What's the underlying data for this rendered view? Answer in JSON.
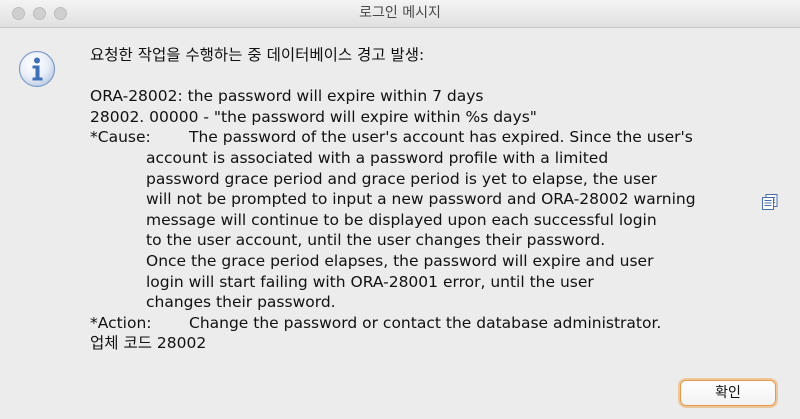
{
  "window": {
    "title": "로그인 메시지"
  },
  "icons": {
    "info": "info-icon",
    "copy": "copy-icon"
  },
  "message": {
    "heading": "요청한 작업을 수행하는 중 데이터베이스 경고 발생:",
    "line1": "ORA-28002: the password will expire within 7 days",
    "line2": "28002. 00000 -  \"the password will expire within %s days\"",
    "cause_label": "*Cause:",
    "cause_lines": [
      "The password of the user's account has expired. Since the user's",
      "account is associated with a password profile with a limited",
      "password grace period and grace period is yet to elapse, the user",
      "will not be prompted to input a new password and ORA-28002 warning",
      "message will continue to be displayed upon each successful login",
      "to the user account, until the user changes their password.",
      "Once the grace period elapses, the password will expire and user",
      "login will start failing with ORA-28001 error, until the user",
      "changes their password."
    ],
    "action_label": "*Action:",
    "action_text": "Change the password or contact the database administrator.",
    "vendor_code": "업체 코드 28002"
  },
  "buttons": {
    "ok_label": "확인"
  },
  "colors": {
    "accent": "#e59a4b",
    "info_icon": "#3f6fb5"
  }
}
